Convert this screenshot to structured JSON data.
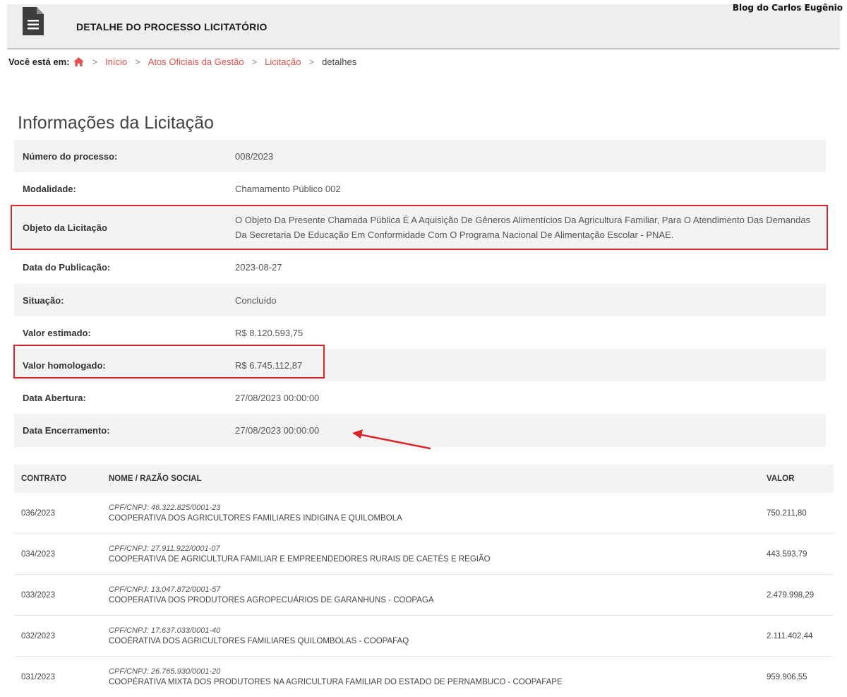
{
  "header": {
    "title": "DETALHE DO PROCESSO LICITATÓRIO",
    "watermark": "Blog do Carlos Eugênio",
    "icon": "document-icon"
  },
  "breadcrumb": {
    "label": "Você está em:",
    "home_icon": "home-icon",
    "items": [
      "Início",
      "Atos Oficiais da Gestão",
      "Licitação"
    ],
    "current": "detalhes"
  },
  "section_title": "Informações da Licitação",
  "info": [
    {
      "label": "Número do processo:",
      "value": "008/2023"
    },
    {
      "label": "Modalidade:",
      "value": "Chamamento Público  002"
    },
    {
      "label": "Objeto da Licitação",
      "value": "O Objeto Da Presente Chamada Pública É A Aquisição De Gêneros Alimentícios Da Agricultura Familiar, Para O Atendimento Das Demandas Da Secretaria De Educação Em Conformidade Com O Programa Nacional De Alimentação Escolar - PNAE."
    },
    {
      "label": "Data do Publicação:",
      "value": "2023-08-27"
    },
    {
      "label": "Situação:",
      "value": "Concluído"
    },
    {
      "label": "Valor estimado:",
      "value": "R$ 8.120.593,75"
    },
    {
      "label": "Valor homologado:",
      "value": "R$ 6.745.112,87"
    },
    {
      "label": "Data Abertura:",
      "value": "27/08/2023 00:00:00"
    },
    {
      "label": "Data Encerramento:",
      "value": "27/08/2023 00:00:00"
    }
  ],
  "contracts": {
    "headers": {
      "contrato": "CONTRATO",
      "nome": "NOME / RAZÃO SOCIAL",
      "valor": "VALOR"
    },
    "rows": [
      {
        "contrato": "036/2023",
        "cnpj": "CPF/CNPJ: 46.322.825/0001-23",
        "nome": "COOPERATIVA DOS AGRICULTORES FAMILIARES INDIGINA E QUILOMBOLA",
        "valor": "750.211,80"
      },
      {
        "contrato": "034/2023",
        "cnpj": "CPF/CNPJ: 27.911.922/0001-07",
        "nome": "COOPERATIVA DE AGRICULTURA FAMILIAR E EMPREENDEDORES RURAIS DE CAETÉS E REGIÃO",
        "valor": "443.593,79"
      },
      {
        "contrato": "033/2023",
        "cnpj": "CPF/CNPJ: 13.047.872/0001-57",
        "nome": "COOPERATIVA DOS PRODUTORES AGROPECUÁRIOS DE GARANHUNS - COOPAGA",
        "valor": "2.479.998,29"
      },
      {
        "contrato": "032/2023",
        "cnpj": "CPF/CNPJ: 17.637.033/0001-40",
        "nome": "COOÉRATIVA DOS AGRICULTORES FAMILIARES QUILOMBOLAS - COOPAFAQ",
        "valor": "2.111.402,44"
      },
      {
        "contrato": "031/2023",
        "cnpj": "CPF/CNPJ: 26.765.930/0001-20",
        "nome": "COOPÉRATIVA MIXTA DOS PRODUTORES NA AGRICULTURA FAMILIAR DO ESTADO DE PERNAMBUCO - COOPAFAPE",
        "valor": "959.906,55"
      }
    ]
  },
  "colors": {
    "accent_link": "#e0504d",
    "highlight": "#d9262b",
    "stripe": "#f3f3f3"
  }
}
